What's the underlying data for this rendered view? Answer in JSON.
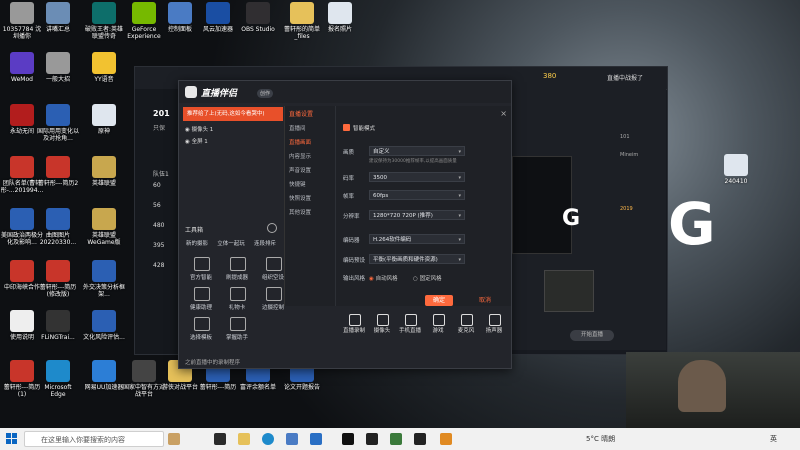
{
  "desktop": {
    "icons": [
      {
        "label": "10357784\n沈圳播你",
        "color": "#999"
      },
      {
        "label": "讲嘴汇总",
        "color": "#6b8db5"
      },
      {
        "label": "破败王者:英雄联盟传奇",
        "color": "#0d6e6a"
      },
      {
        "label": "GeForce Experience",
        "color": "#76b900"
      },
      {
        "label": "控制面板",
        "color": "#4a7bc4"
      },
      {
        "label": "风云加速器",
        "color": "#1a4ea3"
      },
      {
        "label": "OBS Studio",
        "color": "#302e31"
      },
      {
        "label": "蕾轩彤的简单_files",
        "color": "#e6c15a"
      },
      {
        "label": "报名照片",
        "color": "#dfe6ee"
      },
      {
        "label": "WeMod",
        "color": "#5b3cc4"
      },
      {
        "label": "一般大招",
        "color": "#999"
      },
      {
        "label": "YY语音",
        "color": "#f2c230"
      },
      {
        "label": "永劫无间",
        "color": "#b21d1d"
      },
      {
        "label": "国际用用变化以及对抢角...",
        "color": "#2b5fb3"
      },
      {
        "label": "原神",
        "color": "#dfe6ee"
      },
      {
        "label": "团队名单(曹轩彤-...201994...",
        "color": "#c8352a"
      },
      {
        "label": "蕾轩彤---简历2",
        "color": "#c8352a"
      },
      {
        "label": "英雄联盟",
        "color": "#c8a74e"
      },
      {
        "label": "美国政治两极分化及影响...",
        "color": "#2b5fb3"
      },
      {
        "label": "曲图图片20220330...",
        "color": "#2b5fb3"
      },
      {
        "label": "英雄联盟WeGame版",
        "color": "#c8a74e"
      },
      {
        "label": "中印海峡合作",
        "color": "#c8352a"
      },
      {
        "label": "蕾轩彤---简历(修改版)",
        "color": "#c8352a"
      },
      {
        "label": "外交决策分析框架...",
        "color": "#2b5fb3"
      },
      {
        "label": "使用说明",
        "color": "#eee"
      },
      {
        "label": "FLiNGTrai...",
        "color": "#333"
      },
      {
        "label": "文化风险评估...",
        "color": "#2b5fb3"
      },
      {
        "label": "蕾轩彤---简历(1)",
        "color": "#c8352a"
      },
      {
        "label": "Microsoft Edge",
        "color": "#1e8acb"
      },
      {
        "label": "网易UU加速器",
        "color": "#2c7ed6"
      },
      {
        "label": "国家中智有方对战平台",
        "color": "#444"
      },
      {
        "label": "游侠对战平台",
        "color": "#e6c15a"
      },
      {
        "label": "蕾轩彤---简历",
        "color": "#2b5fb3"
      },
      {
        "label": "富评余额名单",
        "color": "#2b5fb3"
      },
      {
        "label": "论文开题报告",
        "color": "#2b5fb3"
      },
      {
        "label": "240410",
        "color": "#dfe6ee"
      }
    ]
  },
  "back_app": {
    "title_partial": "201",
    "sub_partial": "只保",
    "list_header": "队伍1",
    "counts": [
      "60",
      "56",
      "480",
      "395",
      "428"
    ],
    "topbar_number": "380",
    "topbar_label": "直播中战报了",
    "right_label_partial": "Mineim",
    "right_numbers": [
      "101",
      "2019"
    ]
  },
  "dialog": {
    "app_name": "直播伴侣",
    "badge": "创作",
    "notice": "推荐给了上(无码,这如今看哭中)",
    "scenes": [
      {
        "label": "摄像头 1"
      },
      {
        "label": "全屏 1"
      }
    ],
    "toolbar_label": "工具箱",
    "tool_tabs": [
      "新的摄影",
      "立体一起玩",
      "连段排斥"
    ],
    "tools": [
      {
        "label": "官方智能",
        "icon": "scissors-icon"
      },
      {
        "label": "刷提成器",
        "icon": "cloud-icon"
      },
      {
        "label": "组织空设",
        "icon": "clock-icon"
      },
      {
        "label": "健康助理",
        "icon": "heart-icon"
      },
      {
        "label": "礼物卡",
        "icon": "gift-icon"
      },
      {
        "label": "边摄控制",
        "icon": "monitor-icon"
      },
      {
        "label": "选择模板",
        "icon": "star-icon"
      },
      {
        "label": "掌握助手",
        "icon": "robot-icon"
      }
    ],
    "footer_hint": "之前直播中的录制程序"
  },
  "settings": {
    "title": "直播设置",
    "sidebar": [
      "直播间",
      "直播画面",
      "内容显示",
      "声音设置",
      "快捷键",
      "快照设置",
      "其他设置"
    ],
    "active_index": 1,
    "smart_mode_label": "智能模式",
    "smart_mode_checked": true,
    "fields": [
      {
        "label": "画质",
        "value": "自定义",
        "hint": "建议保持为30000推荐帧率,以提高画面质量"
      },
      {
        "label": "码率",
        "value": "3500"
      },
      {
        "label": "帧率",
        "value": "60fps"
      },
      {
        "label": "分辨率",
        "value": "1280*720 720P (推荐)"
      },
      {
        "label": "编码器",
        "value": "H.264软件编码"
      },
      {
        "label": "编码预设",
        "value": "平衡(平衡画质和硬件资源)"
      }
    ],
    "output_label": "输出风格",
    "radio_options": [
      "自动风格",
      "固定风格"
    ],
    "save_label": "确定",
    "cancel_label": "取消"
  },
  "bottom_bar": {
    "items": [
      "直播录制",
      "摄像头",
      "手机直播",
      "游戏",
      "麦克风",
      "扬声器"
    ],
    "start_label": "开始直播"
  },
  "taskbar": {
    "search_placeholder": "在这里输入你要搜索的内容",
    "weather": "5°C 晴朗",
    "lang": "英"
  },
  "colors": {
    "accent": "#e8502a",
    "orange": "#ff6a3d"
  }
}
